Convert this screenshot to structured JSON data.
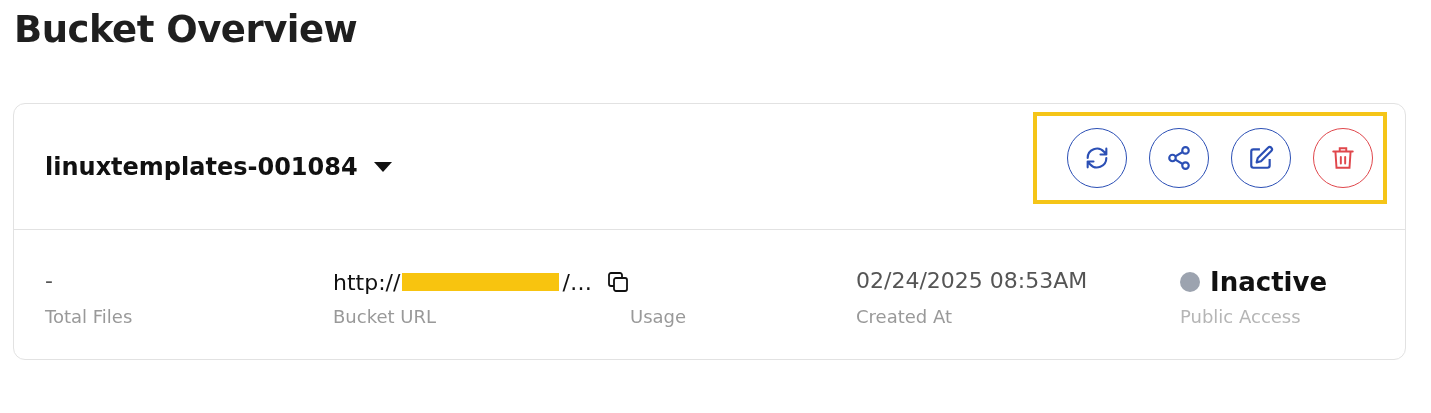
{
  "page": {
    "title": "Bucket Overview"
  },
  "bucket": {
    "name": "linuxtemplates-001084",
    "actions_highlighted": true,
    "actions": [
      {
        "kind": "refresh"
      },
      {
        "kind": "share"
      },
      {
        "kind": "edit"
      },
      {
        "kind": "delete"
      }
    ]
  },
  "stats": {
    "total_files": {
      "value": "-",
      "label": "Total Files"
    },
    "bucket_url": {
      "value_start": "http://",
      "redacted": true,
      "value_end": "/…",
      "label": "Bucket URL"
    },
    "usage": {
      "label": "Usage"
    },
    "created_at": {
      "value": "02/24/2025 08:53AM",
      "label": "Created At"
    },
    "public_access": {
      "value": "Inactive",
      "color": "#9ca3af",
      "label": "Public Access"
    }
  }
}
